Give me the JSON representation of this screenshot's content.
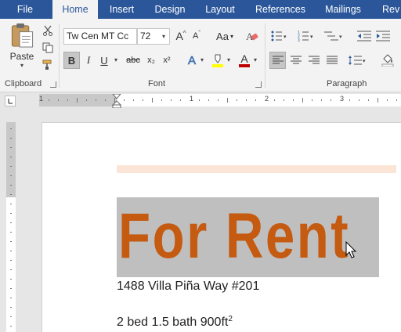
{
  "tabs": {
    "file": "File",
    "home": "Home",
    "insert": "Insert",
    "design": "Design",
    "layout": "Layout",
    "references": "References",
    "mailings": "Mailings",
    "review": "Rev"
  },
  "ribbon": {
    "clipboard": {
      "group_label": "Clipboard",
      "paste_label": "Paste"
    },
    "font": {
      "group_label": "Font",
      "font_name": "Tw Cen MT Cc",
      "font_size": "72",
      "bold": "B",
      "italic": "I",
      "underline": "U",
      "strikethrough": "abc",
      "subscript": "x₂",
      "superscript": "x²",
      "change_case": "Aa",
      "grow_font": "A",
      "shrink_font": "A",
      "text_effects": "A",
      "font_color": "A",
      "highlight_color": "#ffff00",
      "font_color_value": "#c00000"
    },
    "paragraph": {
      "group_label": "Paragraph"
    }
  },
  "ruler": {
    "numbers": [
      "1",
      "1",
      "2",
      "3"
    ]
  },
  "document": {
    "title": "For Rent",
    "title_color": "#c55a11",
    "address": "1488 Villa Piña Way #201",
    "details": "2 bed 1.5 bath 900ft",
    "details_superscript": "2"
  }
}
